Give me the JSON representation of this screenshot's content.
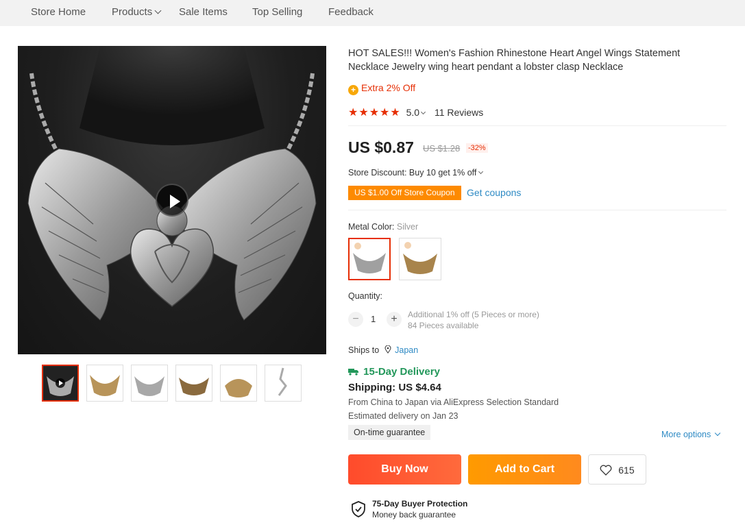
{
  "nav": {
    "items": [
      "Store Home",
      "Products",
      "Sale Items",
      "Top Selling",
      "Feedback"
    ]
  },
  "product": {
    "title": "HOT SALES!!! Women's Fashion Rhinestone Heart Angel Wings Statement Necklace Jewelry wing heart pendant a lobster clasp Necklace",
    "extra_off": "Extra 2% Off",
    "stars": "★★★★★",
    "rating": "5.0",
    "reviews": "11 Reviews",
    "price": "US $0.87",
    "old_price": "US $1.28",
    "discount": "-32%",
    "store_discount": "Store Discount: Buy 10 get 1% off",
    "coupon": "US $1.00 Off Store Coupon",
    "get_coupons": "Get coupons",
    "color_label": "Metal Color:",
    "color_value": "Silver",
    "quantity_label": "Quantity:",
    "quantity": "1",
    "qty_minus": "−",
    "qty_plus": "+",
    "qty_additional": "Additional 1% off (5 Pieces or more)",
    "qty_available": "84 Pieces available"
  },
  "shipping": {
    "ships_to_label": "Ships to",
    "ships_to_location": "Japan",
    "delivery": "15-Day Delivery",
    "cost": "Shipping: US $4.64",
    "from": "From China to Japan via AliExpress Selection Standard",
    "estimated": "Estimated delivery on Jan 23",
    "guarantee": "On-time guarantee",
    "more_options": "More options"
  },
  "actions": {
    "buy_now": "Buy Now",
    "add_to_cart": "Add to Cart",
    "wishlist_count": "615"
  },
  "protection": {
    "title": "75-Day Buyer Protection",
    "subtitle": "Money back guarantee"
  },
  "colors": {
    "accent_red": "#e62e04",
    "orange": "#fd8a00",
    "green": "#22975a",
    "link_blue": "#2e8ac4"
  },
  "icons": [
    "chevron-down-icon",
    "play-icon",
    "coin-icon",
    "star-icon",
    "location-pin-icon",
    "truck-icon",
    "heart-icon",
    "shield-check-icon"
  ]
}
